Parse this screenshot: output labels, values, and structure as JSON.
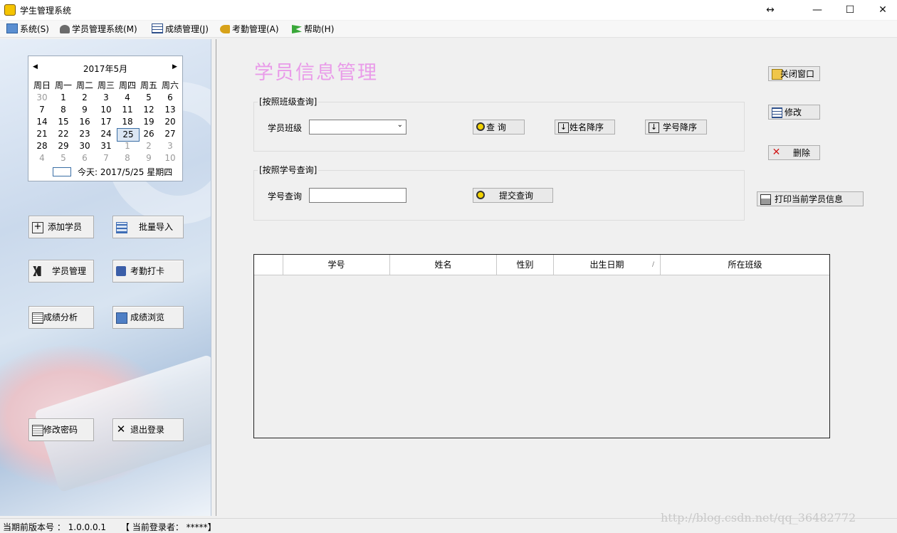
{
  "window": {
    "title": "学生管理系统",
    "resize_symbol": "↔",
    "min_symbol": "—",
    "max_symbol": "☐",
    "close_symbol": "✕"
  },
  "menu": [
    {
      "label": "系统(S)",
      "icon": "computer-icon"
    },
    {
      "label": "学员管理系统(M)",
      "icon": "users-icon"
    },
    {
      "label": "成绩管理(J)",
      "icon": "table-icon"
    },
    {
      "label": "考勤管理(A)",
      "icon": "key-icon"
    },
    {
      "label": "帮助(H)",
      "icon": "flag-icon"
    }
  ],
  "calendar": {
    "month_title": "2017年5月",
    "prev": "◀",
    "next": "▶",
    "weekdays": [
      "周日",
      "周一",
      "周二",
      "周三",
      "周四",
      "周五",
      "周六"
    ],
    "weeks": [
      [
        "30",
        "1",
        "2",
        "3",
        "4",
        "5",
        "6"
      ],
      [
        "7",
        "8",
        "9",
        "10",
        "11",
        "12",
        "13"
      ],
      [
        "14",
        "15",
        "16",
        "17",
        "18",
        "19",
        "20"
      ],
      [
        "21",
        "22",
        "23",
        "24",
        "25",
        "26",
        "27"
      ],
      [
        "28",
        "29",
        "30",
        "31",
        "1",
        "2",
        "3"
      ],
      [
        "4",
        "5",
        "6",
        "7",
        "8",
        "9",
        "10"
      ]
    ],
    "today_label": "今天: 2017/5/25 星期四"
  },
  "left_buttons": {
    "add_student": "添加学员",
    "batch_import": "批量导入",
    "student_manage": "学员管理",
    "attendance": "考勤打卡",
    "score_analysis": "成绩分析",
    "score_browse": "成绩浏览",
    "change_password": "修改密码",
    "logout": "退出登录"
  },
  "main": {
    "title": "学员信息管理",
    "class_group": {
      "title": "[按照班级查询]",
      "label": "学员班级",
      "selected": "",
      "query_btn": "查   询",
      "name_desc_btn": "姓名降序",
      "id_desc_btn": "学号降序"
    },
    "id_group": {
      "title": "[按照学号查询]",
      "label": "学号查询",
      "value": "",
      "submit_btn": "提交查询"
    },
    "side_buttons": {
      "close": "关闭窗口",
      "edit": "修改",
      "delete": "删除",
      "print": "打印当前学员信息"
    },
    "grid": {
      "columns": [
        "学号",
        "姓名",
        "性别",
        "出生日期",
        "所在班级"
      ],
      "sort_mark": "∕"
    }
  },
  "status": {
    "version": "当期前版本号 ： 1.0.0.0.1",
    "user": "【  当前登录者：  *****】"
  },
  "watermark": "http://blog.csdn.net/qq_36482772"
}
